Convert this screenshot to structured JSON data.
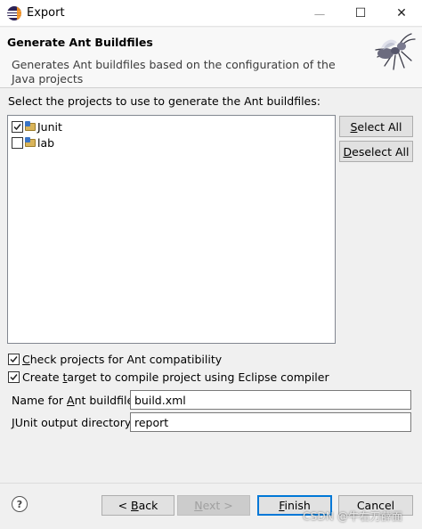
{
  "window": {
    "title": "Export",
    "minimize_glyph": "—",
    "maximize_glyph": "☐",
    "close_glyph": "✕"
  },
  "header": {
    "title": "Generate Ant Buildfiles",
    "description": "Generates Ant buildfiles based on the configuration of the Java projects",
    "icon": "ant-icon"
  },
  "projects": {
    "prompt": "Select the projects to use to generate the Ant buildfiles:",
    "items": [
      {
        "label": "Junit",
        "checked": true
      },
      {
        "label": "lab",
        "checked": false
      }
    ],
    "select_all": {
      "pre": "",
      "key": "S",
      "post": "elect All"
    },
    "deselect_all": {
      "pre": "",
      "key": "D",
      "post": "eselect All"
    }
  },
  "options": {
    "check_ant": {
      "pre": "",
      "key": "C",
      "post": "heck projects for Ant compatibility",
      "checked": true
    },
    "create_target": {
      "pre": "Create ",
      "key": "t",
      "post": "arget to compile project using Eclipse compiler",
      "checked": true
    }
  },
  "fields": {
    "buildfile": {
      "pre": "Name for ",
      "key": "A",
      "post": "nt buildfile:",
      "value": "build.xml"
    },
    "junit_dir": {
      "pre": "",
      "key": "J",
      "post": "Unit output directory:",
      "value": "report"
    }
  },
  "footer": {
    "help_glyph": "?",
    "back": {
      "pre": "< ",
      "key": "B",
      "post": "ack"
    },
    "next": {
      "pre": "",
      "key": "N",
      "post": "ext >"
    },
    "finish": {
      "pre": "",
      "key": "F",
      "post": "inish"
    },
    "cancel": "Cancel",
    "watermark": "CSDN @牛右刀薛面"
  },
  "colors": {
    "focus_border": "#0078d7",
    "window_bg": "#f0f0f0"
  }
}
